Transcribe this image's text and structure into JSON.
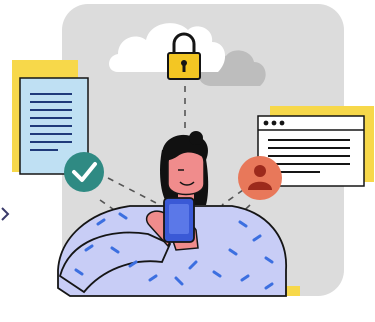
{
  "illustration": {
    "subject": "person-using-phone-cloud-security",
    "colors": {
      "backdrop": "#dcdcdc",
      "cloud_front": "#ffffff",
      "cloud_back": "#bdbdbd",
      "lock": "#f3c623",
      "document_back": "#f7d84a",
      "document_front": "#bfe0f3",
      "check_badge": "#2f8a83",
      "user_badge": "#e8785a",
      "browser_window": "#ffffff",
      "browser_back": "#f7d84a",
      "sweater": "#c8cdf6",
      "sweater_dots": "#3c6fe0",
      "skin": "#f08c8c",
      "hair": "#111111",
      "phone": "#3a59d6",
      "outline": "#151515"
    },
    "icons": [
      "padlock-icon",
      "checkmark-icon",
      "user-avatar-icon",
      "document-icon",
      "browser-window-icon",
      "cloud-icon",
      "smartphone-icon"
    ]
  }
}
